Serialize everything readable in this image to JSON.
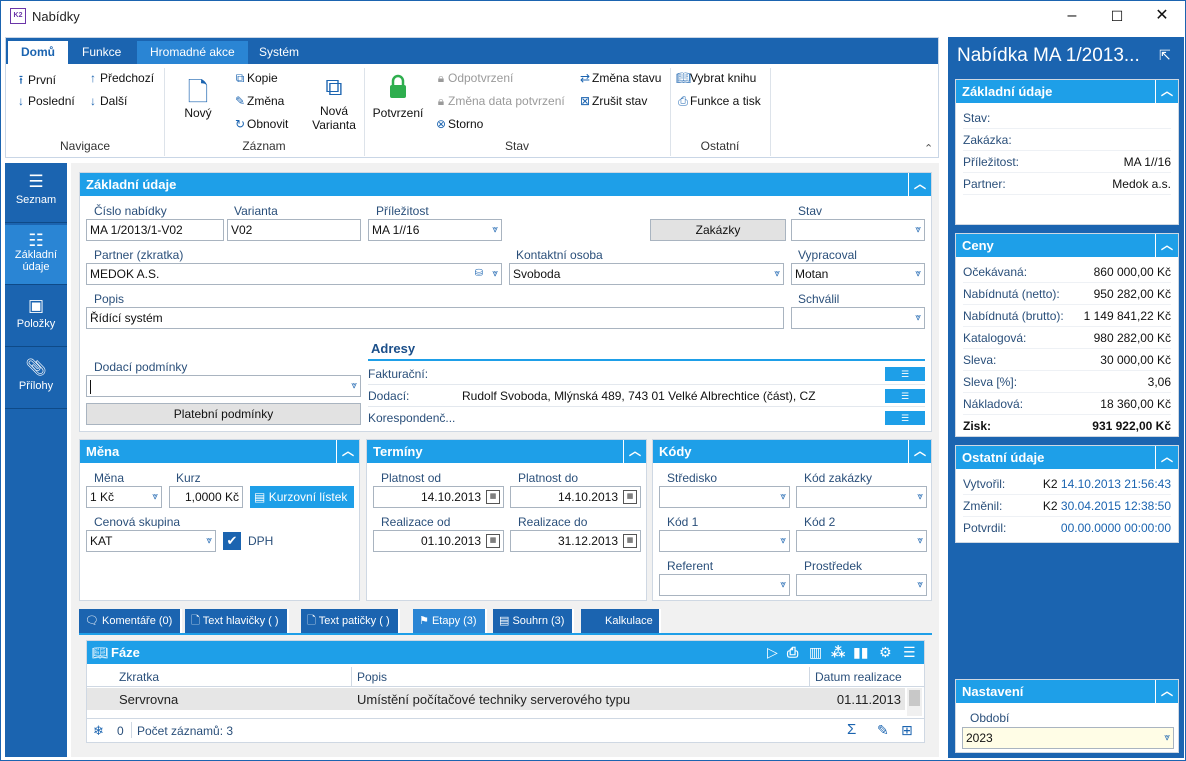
{
  "window": {
    "title": "Nabídky",
    "minimize": "–",
    "maximize": "☐",
    "close": "✕"
  },
  "ribbon": {
    "tabs": [
      "Domů",
      "Funkce",
      "Hromadné akce",
      "Systém"
    ],
    "navigace": {
      "first": "První",
      "last": "Poslední",
      "prev": "Předchozí",
      "next": "Další",
      "group": "Navigace"
    },
    "zaznam": {
      "new": "Nový",
      "copy": "Kopie",
      "change": "Změna",
      "refresh": "Obnovit",
      "variant1": "Nová",
      "variant2": "Varianta",
      "group": "Záznam"
    },
    "stav": {
      "confirm": "Potvrzení",
      "unconfirm": "Odpotvrzení",
      "change_date": "Změna data potvrzení",
      "storno": "Storno",
      "change_state": "Změna stavu",
      "cancel_state": "Zrušit stav",
      "group": "Stav"
    },
    "ostatni": {
      "book": "Vybrat knihu",
      "print": "Funkce a tisk",
      "group": "Ostatní"
    }
  },
  "nav": [
    {
      "label1": "Seznam",
      "label2": ""
    },
    {
      "label1": "Základní",
      "label2": "údaje"
    },
    {
      "label1": "Položky",
      "label2": ""
    },
    {
      "label1": "Přílohy",
      "label2": ""
    }
  ],
  "basic": {
    "title": "Základní údaje",
    "cislo_label": "Číslo nabídky",
    "cislo": "MA 1/2013/1-V02",
    "varianta_label": "Varianta",
    "varianta": "V02",
    "prilezitost_label": "Příležitost",
    "prilezitost": "MA 1//16",
    "zakazky_btn": "Zakázky",
    "stav_label": "Stav",
    "stav": "",
    "partner_label": "Partner (zkratka)",
    "partner": "MEDOK A.S.",
    "kontakt_label": "Kontaktní osoba",
    "kontakt": "Svoboda",
    "vypracoval_label": "Vypracoval",
    "vypracoval": "Motan",
    "popis_label": "Popis",
    "popis": "Řídící systém",
    "schvalil_label": "Schválil",
    "schvalil": "",
    "dodaci_label": "Dodací podmínky",
    "dodaci": "",
    "platebni_btn": "Platební podmínky",
    "adresy_title": "Adresy",
    "fakturacni_label": "Fakturační:",
    "fakturacni": "",
    "dodaci_adr_label": "Dodací:",
    "dodaci_adr": "Rudolf Svoboda, Mlýnská 489, 743 01  Velké Albrechtice (část), CZ",
    "koresp_label": "Korespondenč..."
  },
  "mena": {
    "title": "Měna",
    "mena_label": "Měna",
    "mena": "1 Kč",
    "kurz_label": "Kurz",
    "kurz": "1,0000 Kč",
    "kurzovni_btn": "Kurzovní lístek",
    "skupina_label": "Cenová skupina",
    "skupina": "KAT",
    "dph_label": "DPH"
  },
  "terminy": {
    "title": "Termíny",
    "platnost_od_label": "Platnost od",
    "platnost_od": "14.10.2013",
    "platnost_do_label": "Platnost do",
    "platnost_do": "14.10.2013",
    "realizace_od_label": "Realizace od",
    "realizace_od": "01.10.2013",
    "realizace_do_label": "Realizace do",
    "realizace_do": "31.12.2013"
  },
  "kody": {
    "title": "Kódy",
    "stredisko_label": "Středisko",
    "kod_zakazky_label": "Kód zakázky",
    "kod1_label": "Kód 1",
    "kod2_label": "Kód 2",
    "referent_label": "Referent",
    "prostredek_label": "Prostředek"
  },
  "bottom_tabs": [
    "Komentáře (0)",
    "Text hlavičky ( )",
    "Text patičky ( )",
    "Etapy (3)",
    "Souhrn (3)",
    "Kalkulace"
  ],
  "faze": {
    "title": "Fáze",
    "col_zkratka": "Zkratka",
    "col_popis": "Popis",
    "col_datum": "Datum realizace",
    "rows": [
      {
        "zkratka": "Servrovna",
        "popis": "Umístění počítačové techniky serverového typu",
        "datum": "01.11.2013"
      }
    ],
    "footer_count_num": "0",
    "footer_count": "Počet záznamů: 3"
  },
  "right": {
    "title": "Nabídka MA 1/2013...",
    "zakladni": {
      "title": "Základní údaje",
      "stav_l": "Stav:",
      "stav": "",
      "zakazka_l": "Zakázka:",
      "zakazka": "",
      "prilezitost_l": "Příležitost:",
      "prilezitost": "MA 1//16",
      "partner_l": "Partner:",
      "partner": "Medok a.s."
    },
    "ceny": {
      "title": "Ceny",
      "rows": [
        {
          "l": "Očekávaná:",
          "v": "860 000,00 Kč"
        },
        {
          "l": "Nabídnutá (netto):",
          "v": "950 282,00 Kč"
        },
        {
          "l": "Nabídnutá (brutto):",
          "v": "1 149 841,22 Kč"
        },
        {
          "l": "Katalogová:",
          "v": "980 282,00 Kč"
        },
        {
          "l": "Sleva:",
          "v": "30 000,00 Kč"
        },
        {
          "l": "Sleva [%]:",
          "v": "3,06"
        },
        {
          "l": "Nákladová:",
          "v": "18 360,00 Kč"
        },
        {
          "l": "Zisk:",
          "v": "931 922,00 Kč"
        }
      ]
    },
    "ostatni": {
      "title": "Ostatní údaje",
      "vytvoril_l": "Vytvořil:",
      "vytvoril_u": "K2",
      "vytvoril": "14.10.2013 21:56:43",
      "zmenil_l": "Změnil:",
      "zmenil_u": "K2",
      "zmenil": "30.04.2015 12:38:50",
      "potvrdil_l": "Potvrdil:",
      "potvrdil": "00.00.0000 00:00:00"
    },
    "nastaveni": {
      "title": "Nastavení",
      "obdobi_l": "Období",
      "obdobi": "2023"
    }
  }
}
